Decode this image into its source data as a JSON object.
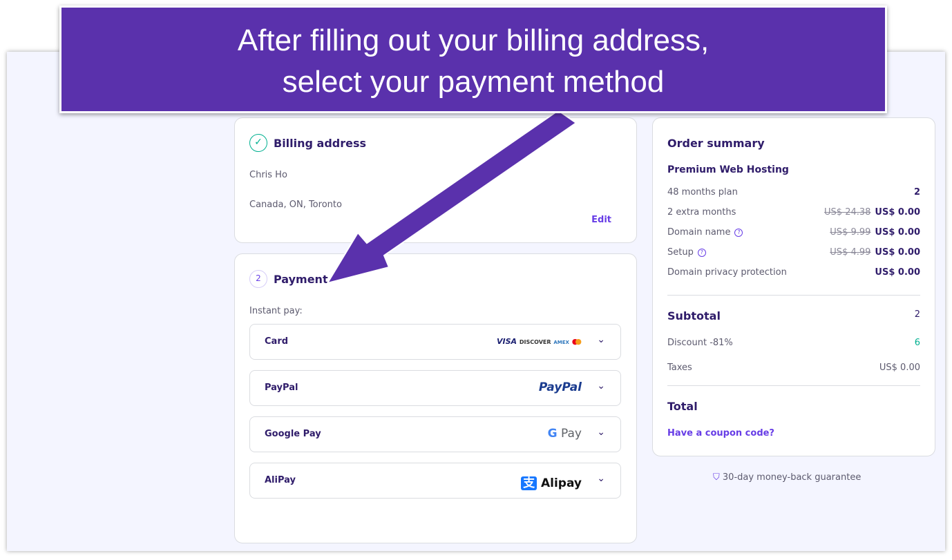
{
  "banner": {
    "line1": "After filling out your billing address,",
    "line2": "select your payment method"
  },
  "billing": {
    "title": "Billing address",
    "name": "Chris Ho",
    "location": "Canada, ON, Toronto",
    "edit": "Edit"
  },
  "payment": {
    "step": "2",
    "title": "Payment",
    "instant": "Instant pay:",
    "methods": [
      {
        "label": "Card",
        "logo": "VISA DISCOVER AMERICAN EXPRESS mastercard"
      },
      {
        "label": "PayPal",
        "logo": "PayPal"
      },
      {
        "label": "Google Pay",
        "logo": "Pay"
      },
      {
        "label": "AliPay",
        "logo": "Alipay"
      }
    ]
  },
  "summary": {
    "title": "Order summary",
    "product": "Premium Web Hosting",
    "rows": [
      {
        "label": "48 months plan",
        "old": "",
        "value": "2"
      },
      {
        "label": "2 extra months",
        "old": "US$ 24.38",
        "value": "US$ 0.00"
      },
      {
        "label": "Domain name",
        "old": "US$ 9.99",
        "value": "US$ 0.00"
      },
      {
        "label": "Setup",
        "old": "US$ 4.99",
        "value": "US$ 0.00"
      },
      {
        "label": "Domain privacy protection",
        "old": "",
        "value": "US$ 0.00"
      }
    ],
    "subtotal": "Subtotal",
    "subtotal_value": "2",
    "discount": "Discount -81%",
    "discount_value": "6",
    "taxes": "Taxes",
    "taxes_value": "US$ 0.00",
    "total": "Total",
    "coupon": "Have a coupon code?"
  },
  "guarantee": "30-day money-back guarantee",
  "colors": {
    "accent": "#673de6",
    "banner": "#5a31ac",
    "success": "#00b090"
  }
}
